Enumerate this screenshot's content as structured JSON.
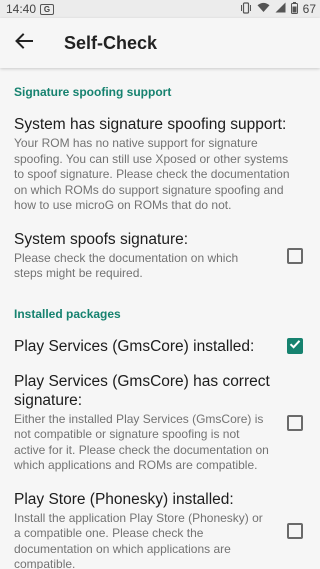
{
  "status_bar": {
    "time": "14:40",
    "badge": "G",
    "battery": "67"
  },
  "app_bar": {
    "title": "Self-Check"
  },
  "sections": [
    {
      "header": "Signature spoofing support",
      "items": [
        {
          "title": "System has signature spoofing support:",
          "summary": "Your ROM has no native support for signature spoofing. You can still use Xposed or other systems to spoof signature. Please check the documentation on which ROMs do support signature spoofing and how to use microG on ROMs that do not.",
          "checked": null
        },
        {
          "title": "System spoofs signature:",
          "summary": "Please check the documentation on which steps might be required.",
          "checked": false
        }
      ]
    },
    {
      "header": "Installed packages",
      "items": [
        {
          "title": "Play Services (GmsCore) installed:",
          "summary": "",
          "checked": true
        },
        {
          "title": "Play Services (GmsCore) has correct signature:",
          "summary": "Either the installed Play Services (GmsCore) is not compatible or signature spoofing is not active for it. Please check the documentation on which applications and ROMs are compatible.",
          "checked": false
        },
        {
          "title": "Play Store (Phonesky) installed:",
          "summary": "Install the application Play Store (Phonesky) or a compatible one. Please check the documentation on which applications are compatible.",
          "checked": false
        }
      ]
    }
  ],
  "colors": {
    "accent": "#16826f",
    "background": "#f6f6f6",
    "summary_text": "#737373"
  }
}
